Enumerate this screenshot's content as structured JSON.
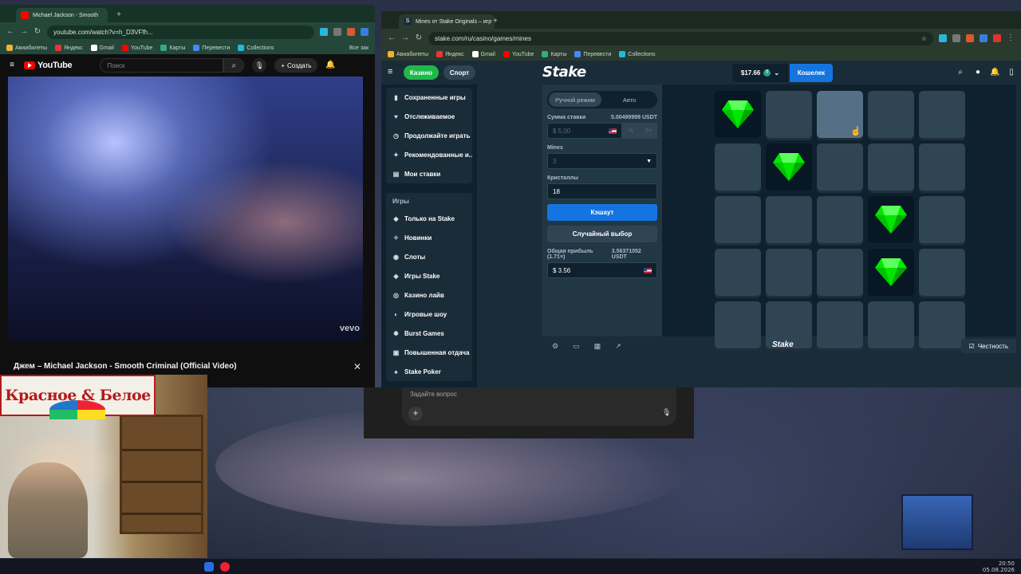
{
  "youtube_browser": {
    "tab_title": "Michael Jackson - Smooth",
    "url": "youtube.com/watch?v=h_D3VFfh...",
    "bookmarks": [
      "Авиабилеты",
      "Яндекс",
      "Gmail",
      "YouTube",
      "Карты",
      "Перевести",
      "Collections"
    ],
    "bookmark_tail": "Все зак",
    "yt_logo": "YouTube",
    "search_placeholder": "Поиск",
    "create_label": "Создать",
    "video_watermark": "vevo",
    "video_title": "Джем – Michael Jackson - Smooth Criminal (Official Video)",
    "close_glyph": "✕"
  },
  "stake_browser": {
    "tab_title": "Mines от Stake Originals – игр",
    "url": "stake.com/ru/casino/games/mines",
    "bookmarks": [
      "Авиабилеты",
      "Яндекс",
      "Gmail",
      "YouTube",
      "Карты",
      "Перевести",
      "Collections"
    ]
  },
  "stake": {
    "casino_label": "Казино",
    "sport_label": "Спорт",
    "logo": "Stake",
    "balance": "$17.66",
    "coin_symbol": "T",
    "wallet_label": "Кошелек",
    "sidebar_top": [
      {
        "label": "Сохраненные игры",
        "icon": "bookmark-icon",
        "glyph": "▮"
      },
      {
        "label": "Отслеживаемое",
        "icon": "heart-icon",
        "glyph": "♥"
      },
      {
        "label": "Продолжайте играть",
        "icon": "history-icon",
        "glyph": "◷"
      },
      {
        "label": "Рекомендованные и...",
        "icon": "recommended-icon",
        "glyph": "✦"
      },
      {
        "label": "Мои ставки",
        "icon": "bets-icon",
        "glyph": "▤"
      }
    ],
    "games_heading": "Игры",
    "sidebar_games": [
      {
        "label": "Только на Stake",
        "icon": "stake-only-icon",
        "glyph": "◆"
      },
      {
        "label": "Новинки",
        "icon": "new-icon",
        "glyph": "✧"
      },
      {
        "label": "Слоты",
        "icon": "slots-icon",
        "glyph": "◉"
      },
      {
        "label": "Игры Stake",
        "icon": "stake-games-icon",
        "glyph": "◈"
      },
      {
        "label": "Казино лайв",
        "icon": "live-casino-icon",
        "glyph": "◎"
      },
      {
        "label": "Игровые шоу",
        "icon": "game-shows-icon",
        "glyph": "◐"
      },
      {
        "label": "Burst Games",
        "icon": "burst-games-icon",
        "glyph": "✹"
      },
      {
        "label": "Повышенная отдача",
        "icon": "boosted-rtp-icon",
        "glyph": "▣"
      },
      {
        "label": "Stake Poker",
        "icon": "poker-icon",
        "glyph": "♠"
      }
    ],
    "controls": {
      "mode_manual": "Ручной режим",
      "mode_auto": "Авто",
      "bet_label": "Сумма ставки",
      "bet_usdt": "5.00499999 USDT",
      "bet_value": "$ 5,00",
      "half": "½",
      "double": "2×",
      "mines_label": "Mines",
      "mines_value": "3",
      "gems_label": "Кристаллы",
      "gems_value": "18",
      "cashout_label": "Кэшаут",
      "random_label": "Случайный выбор",
      "profit_label": "Общая прибыль (1.71×)",
      "profit_usdt": "3.56371052 USDT",
      "profit_value": "$ 3.56"
    },
    "board": {
      "rows": 5,
      "cols": 5,
      "gem_color": "#00e701",
      "revealed_gems": [
        [
          0,
          0
        ],
        [
          1,
          1
        ],
        [
          2,
          3
        ],
        [
          3,
          3
        ]
      ],
      "hover_tile": [
        0,
        2
      ]
    },
    "footer_logo": "Stake",
    "fairness_label": "Честность"
  },
  "ask_panel": {
    "placeholder": "Задайте вопрос",
    "plus": "+"
  },
  "overlay": {
    "logo_text": "Красное & Белое"
  },
  "taskbar": {
    "time": "20:50",
    "date": "05.08.2026"
  }
}
